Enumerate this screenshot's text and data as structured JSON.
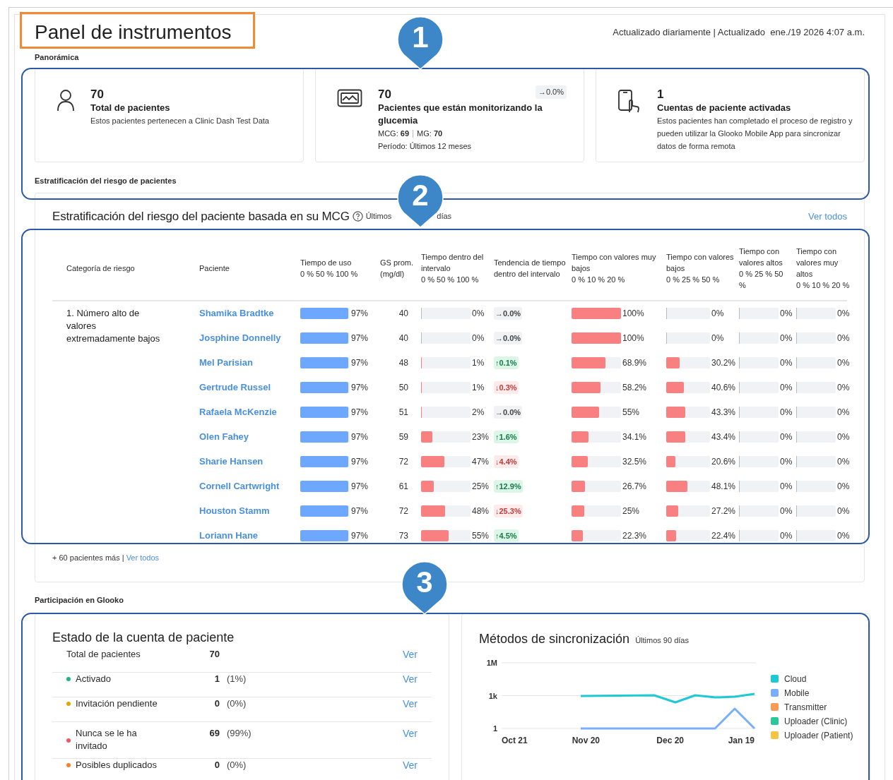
{
  "header": {
    "title": "Panel de instrumentos",
    "updated": "Actualizado diariamente | Actualizado  ene./19 2026 4:07 a.m."
  },
  "overview": {
    "label": "Panorámica",
    "cards": [
      {
        "kind": "patients",
        "value": "70",
        "title": "Total de pacientes",
        "description": "Estos pacientes pertenecen a Clinic Dash Test Data"
      },
      {
        "kind": "monitoring",
        "value": "70",
        "title": "Pacientes que están monitorizando la glucemia",
        "trend": "→0.0%",
        "stats": [
          {
            "label": "MCG:",
            "value": "69"
          },
          {
            "label": "MG:",
            "value": "70"
          }
        ],
        "period": "Período: Últimos 12 meses"
      },
      {
        "kind": "activated",
        "value": "1",
        "title": "Cuentas de paciente activadas",
        "description": "Estos pacientes han completado el proceso de registro y pueden utilizar la Glooko Mobile App para sincronizar datos de forma remota"
      }
    ]
  },
  "risk": {
    "label": "Estratificación del riesgo de pacientes",
    "title": "Estratificación del riesgo del paciente basada en su MCG",
    "period": [
      "Últimos",
      "días"
    ],
    "view_all": "Ver todos",
    "columns": [
      {
        "label": "Categoría de riesgo"
      },
      {
        "label": "Paciente"
      },
      {
        "label": "Tiempo de uso",
        "scale": "0 % 50 % 100 %"
      },
      {
        "label": "GS prom.",
        "unit": "(mg/dl)"
      },
      {
        "label": "Tiempo dentro del intervalo",
        "scale": "0 % 50 % 100 %"
      },
      {
        "label": "Tendencia de tiempo dentro del intervalo"
      },
      {
        "label": "Tiempo con valores muy bajos",
        "scale": "0 % 10 % 20 %"
      },
      {
        "label": "Tiempo con valores bajos",
        "scale": "0 % 25 % 50 %"
      },
      {
        "label": "Tiempo con valores altos",
        "scale": "0 % 25 % 50 %"
      },
      {
        "label": "Tiempo con valores muy altos",
        "scale": "0 % 10 % 20 %"
      }
    ],
    "groups": [
      {
        "category": "1. Número alto de valores extremadamente bajos",
        "rows": [
          {
            "patient": "Shamika Bradtke",
            "usage": {
              "text": "97%",
              "level": 0.97
            },
            "avg_glucose": "40",
            "in_range": {
              "text": "0%",
              "level": 0
            },
            "trend": {
              "kind": "flat",
              "text": "→0.0%"
            },
            "very_low": {
              "text": "100%",
              "level": 1
            },
            "low": {
              "text": "0%",
              "level": 0
            },
            "high": {
              "text": "0%",
              "level": 0
            },
            "very_high": {
              "text": "0%",
              "level": 0
            }
          },
          {
            "patient": "Josphine Donnelly",
            "usage": {
              "text": "97%",
              "level": 0.97
            },
            "avg_glucose": "40",
            "in_range": {
              "text": "0%",
              "level": 0
            },
            "trend": {
              "kind": "flat",
              "text": "→0.0%"
            },
            "very_low": {
              "text": "100%",
              "level": 1
            },
            "low": {
              "text": "0%",
              "level": 0
            },
            "high": {
              "text": "0%",
              "level": 0
            },
            "very_high": {
              "text": "0%",
              "level": 0
            }
          },
          {
            "patient": "Mel Parisian",
            "usage": {
              "text": "97%",
              "level": 0.97
            },
            "avg_glucose": "48",
            "in_range": {
              "text": "1%",
              "level": 0.01
            },
            "trend": {
              "kind": "up",
              "text": "↑0.1%"
            },
            "very_low": {
              "text": "68.9%",
              "level": 0.689
            },
            "low": {
              "text": "30.2%",
              "level": 0.302
            },
            "high": {
              "text": "0%",
              "level": 0
            },
            "very_high": {
              "text": "0%",
              "level": 0
            }
          },
          {
            "patient": "Gertrude Russel",
            "usage": {
              "text": "97%",
              "level": 0.97
            },
            "avg_glucose": "50",
            "in_range": {
              "text": "1%",
              "level": 0.01
            },
            "trend": {
              "kind": "down",
              "text": "↓0.3%"
            },
            "very_low": {
              "text": "58.2%",
              "level": 0.582
            },
            "low": {
              "text": "40.6%",
              "level": 0.406
            },
            "high": {
              "text": "0%",
              "level": 0
            },
            "very_high": {
              "text": "0%",
              "level": 0
            }
          },
          {
            "patient": "Rafaela McKenzie",
            "usage": {
              "text": "97%",
              "level": 0.97
            },
            "avg_glucose": "51",
            "in_range": {
              "text": "2%",
              "level": 0.02
            },
            "trend": {
              "kind": "flat",
              "text": "→0.0%"
            },
            "very_low": {
              "text": "55%",
              "level": 0.55
            },
            "low": {
              "text": "43.3%",
              "level": 0.433
            },
            "high": {
              "text": "0%",
              "level": 0
            },
            "very_high": {
              "text": "0%",
              "level": 0
            }
          },
          {
            "patient": "Olen Fahey",
            "usage": {
              "text": "97%",
              "level": 0.97
            },
            "avg_glucose": "59",
            "in_range": {
              "text": "23%",
              "level": 0.23
            },
            "trend": {
              "kind": "up",
              "text": "↑1.6%"
            },
            "very_low": {
              "text": "34.1%",
              "level": 0.341
            },
            "low": {
              "text": "43.4%",
              "level": 0.434
            },
            "high": {
              "text": "0%",
              "level": 0
            },
            "very_high": {
              "text": "0%",
              "level": 0
            }
          },
          {
            "patient": "Sharie Hansen",
            "usage": {
              "text": "97%",
              "level": 0.97
            },
            "avg_glucose": "72",
            "in_range": {
              "text": "47%",
              "level": 0.47
            },
            "trend": {
              "kind": "down",
              "text": "↓4.4%"
            },
            "very_low": {
              "text": "32.5%",
              "level": 0.325
            },
            "low": {
              "text": "20.6%",
              "level": 0.206
            },
            "high": {
              "text": "0%",
              "level": 0
            },
            "very_high": {
              "text": "0%",
              "level": 0
            }
          },
          {
            "patient": "Cornell Cartwright",
            "usage": {
              "text": "97%",
              "level": 0.97
            },
            "avg_glucose": "61",
            "in_range": {
              "text": "25%",
              "level": 0.25
            },
            "trend": {
              "kind": "up",
              "text": "↑12.9%"
            },
            "very_low": {
              "text": "26.7%",
              "level": 0.267
            },
            "low": {
              "text": "48.1%",
              "level": 0.481
            },
            "high": {
              "text": "0%",
              "level": 0
            },
            "very_high": {
              "text": "0%",
              "level": 0
            }
          },
          {
            "patient": "Houston Stamm",
            "usage": {
              "text": "97%",
              "level": 0.97
            },
            "avg_glucose": "72",
            "in_range": {
              "text": "48%",
              "level": 0.48
            },
            "trend": {
              "kind": "down",
              "text": "↓25.3%"
            },
            "very_low": {
              "text": "25%",
              "level": 0.25
            },
            "low": {
              "text": "27.2%",
              "level": 0.272
            },
            "high": {
              "text": "0%",
              "level": 0
            },
            "very_high": {
              "text": "0%",
              "level": 0
            }
          },
          {
            "patient": "Loriann Hane",
            "usage": {
              "text": "97%",
              "level": 0.97
            },
            "avg_glucose": "73",
            "in_range": {
              "text": "55%",
              "level": 0.55
            },
            "trend": {
              "kind": "up",
              "text": "↑4.5%"
            },
            "very_low": {
              "text": "22.3%",
              "level": 0.223
            },
            "low": {
              "text": "22.4%",
              "level": 0.224
            },
            "high": {
              "text": "0%",
              "level": 0
            },
            "very_high": {
              "text": "0%",
              "level": 0
            }
          }
        ]
      }
    ],
    "more": "+ 60 pacientes más |",
    "more_link": "Ver todos"
  },
  "engagement": {
    "label": "Participación en Glooko",
    "account": {
      "title": "Estado de la cuenta de paciente",
      "rows": [
        {
          "label": "Total de pacientes",
          "count": "70",
          "link": "Ver"
        },
        {
          "label": "Activado",
          "color": "#1fb57f",
          "count": "1",
          "percent": "(1%)",
          "link": "Ver"
        },
        {
          "label": "Invitación pendiente",
          "color": "#e0a800",
          "count": "0",
          "percent": "(0%)",
          "link": "Ver"
        },
        {
          "label": "Nunca se le ha invitado",
          "color": "#ee5a66",
          "count": "69",
          "percent": "(99%)",
          "link": "Ver"
        },
        {
          "label": "Posibles duplicados",
          "color": "#f5822a",
          "count": "0",
          "percent": "(0%)",
          "link": "Ver"
        }
      ]
    },
    "sync": {
      "title": "Métodos de sincronización",
      "period": "Últimos 90 días",
      "chart": {
        "y_labels": [
          "1M",
          "1k",
          "1"
        ],
        "x_labels": [
          "Oct 21",
          "Nov 20",
          "Dec 20",
          "Jan 19"
        ],
        "legend": [
          {
            "name": "Cloud",
            "color": "#1ec8d4"
          },
          {
            "name": "Mobile",
            "color": "#7aaefc"
          },
          {
            "name": "Transmitter",
            "color": "#f99a55"
          },
          {
            "name": "Uploader (Clinic)",
            "color": "#2ac79a"
          },
          {
            "name": "Uploader (Patient)",
            "color": "#f6c343"
          }
        ]
      }
    }
  },
  "annotations": [
    {
      "number": "1"
    },
    {
      "number": "2"
    },
    {
      "number": "3"
    }
  ]
}
